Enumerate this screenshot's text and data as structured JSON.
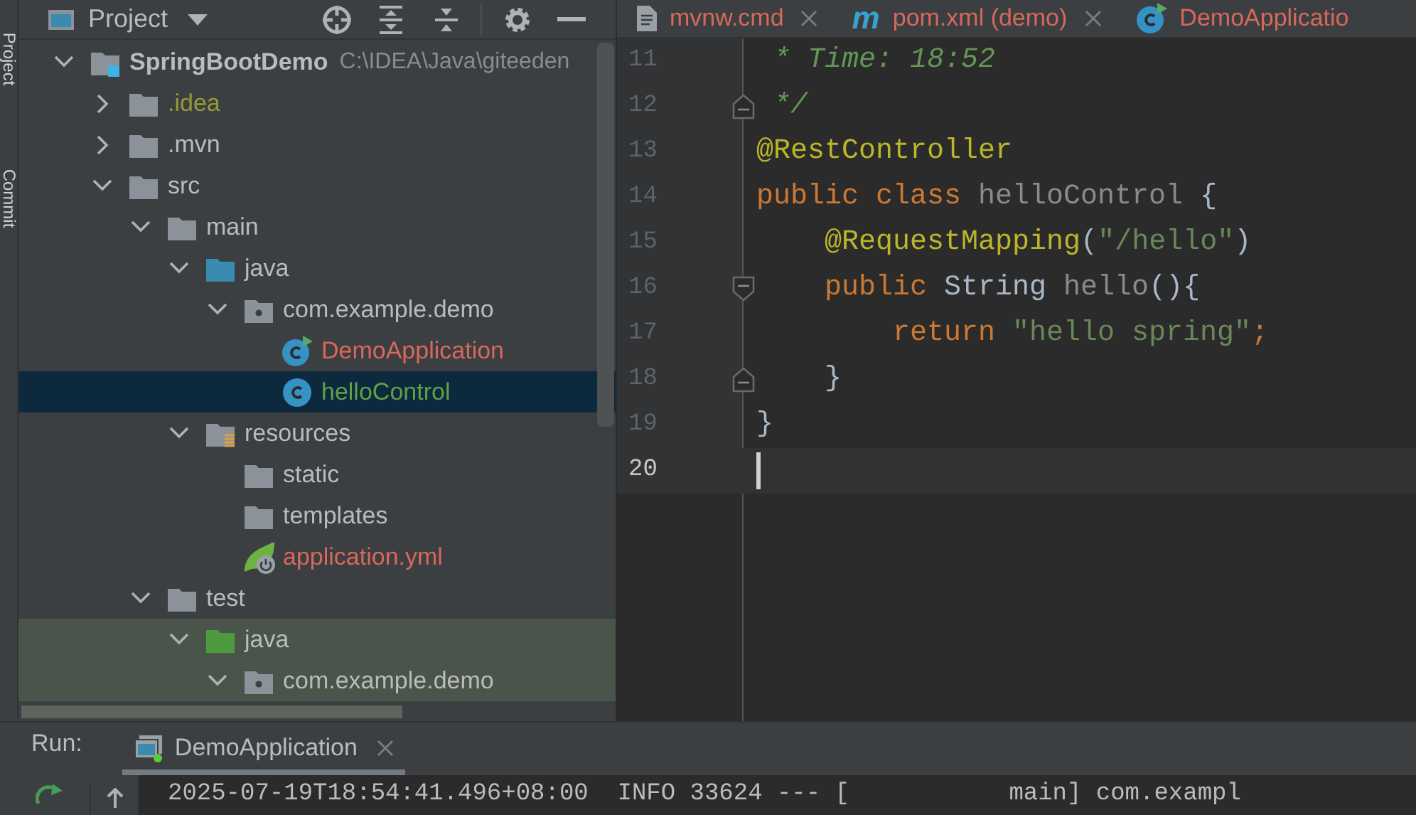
{
  "side_strip": {
    "labels": [
      "Project",
      "Commit"
    ]
  },
  "project_panel": {
    "title": "Project",
    "tree": [
      {
        "label": "SpringBootDemo",
        "path": "C:\\IDEA\\Java\\giteeden",
        "kind": "project",
        "color": "#bbbbbb",
        "expanded": true,
        "selected": false,
        "test_scope": false,
        "children": [
          {
            "label": ".idea",
            "kind": "folder",
            "color": "#999933",
            "expanded": false,
            "selected": false,
            "test_scope": false
          },
          {
            "label": ".mvn",
            "kind": "folder",
            "color": "#bbbbbb",
            "expanded": false,
            "selected": false,
            "test_scope": false
          },
          {
            "label": "src",
            "kind": "folder",
            "color": "#bbbbbb",
            "expanded": true,
            "selected": false,
            "test_scope": false,
            "children": [
              {
                "label": "main",
                "kind": "folder",
                "color": "#bbbbbb",
                "expanded": true,
                "selected": false,
                "test_scope": false,
                "children": [
                  {
                    "label": "java",
                    "kind": "source-folder",
                    "color": "#bbbbbb",
                    "expanded": true,
                    "selected": false,
                    "test_scope": false,
                    "children": [
                      {
                        "label": "com.example.demo",
                        "kind": "package",
                        "color": "#bbbbbb",
                        "expanded": true,
                        "selected": false,
                        "test_scope": false,
                        "children": [
                          {
                            "label": "DemoApplication",
                            "kind": "main-class",
                            "color": "#d7685b",
                            "selected": false,
                            "test_scope": false
                          },
                          {
                            "label": "helloControl",
                            "kind": "class",
                            "color": "#62a046",
                            "selected": true,
                            "test_scope": false
                          }
                        ]
                      }
                    ]
                  },
                  {
                    "label": "resources",
                    "kind": "resources-folder",
                    "color": "#bbbbbb",
                    "expanded": true,
                    "selected": false,
                    "test_scope": false,
                    "children": [
                      {
                        "label": "static",
                        "kind": "folder",
                        "color": "#bbbbbb",
                        "selected": false,
                        "test_scope": false
                      },
                      {
                        "label": "templates",
                        "kind": "folder",
                        "color": "#bbbbbb",
                        "selected": false,
                        "test_scope": false
                      },
                      {
                        "label": "application.yml",
                        "kind": "spring-config",
                        "color": "#d7685b",
                        "selected": false,
                        "test_scope": false
                      }
                    ]
                  }
                ]
              },
              {
                "label": "test",
                "kind": "folder",
                "color": "#bbbbbb",
                "expanded": true,
                "selected": false,
                "test_scope": false,
                "children": [
                  {
                    "label": "java",
                    "kind": "test-folder",
                    "color": "#bbbbbb",
                    "expanded": true,
                    "selected": false,
                    "test_scope": true,
                    "children": [
                      {
                        "label": "com.example.demo",
                        "kind": "package",
                        "color": "#bbbbbb",
                        "expanded": true,
                        "selected": false,
                        "test_scope": true
                      }
                    ]
                  }
                ]
              }
            ]
          }
        ]
      }
    ]
  },
  "editor": {
    "tabs": [
      {
        "label": "mvnw.cmd",
        "kind": "file",
        "selected": false
      },
      {
        "label": "pom.xml (demo)",
        "kind": "maven",
        "icon_text": "m",
        "selected": false
      },
      {
        "label": "DemoApplicatio",
        "kind": "main-class",
        "selected": false
      }
    ],
    "lines": [
      {
        "number": "11",
        "fold_open": false,
        "fold_close": false,
        "current": false,
        "tokens": [
          {
            "text": " * Time: 18:52",
            "kind": "comment"
          }
        ]
      },
      {
        "number": "12",
        "fold_open": false,
        "fold_close": true,
        "current": false,
        "tokens": [
          {
            "text": " */",
            "kind": "comment"
          }
        ]
      },
      {
        "number": "13",
        "fold_open": false,
        "fold_close": false,
        "current": false,
        "tokens": [
          {
            "text": "@RestController",
            "kind": "annotation"
          }
        ]
      },
      {
        "number": "14",
        "fold_open": false,
        "fold_close": false,
        "current": false,
        "tokens": [
          {
            "text": "public class ",
            "kind": "keyword"
          },
          {
            "text": "helloControl",
            "kind": "unused"
          },
          {
            "text": " {",
            "kind": "plain"
          }
        ]
      },
      {
        "number": "15",
        "fold_open": false,
        "fold_close": false,
        "current": false,
        "tokens": [
          {
            "text": "    @RequestMapping",
            "kind": "annotation"
          },
          {
            "text": "(",
            "kind": "plain"
          },
          {
            "text": "\"/hello\"",
            "kind": "string"
          },
          {
            "text": ")",
            "kind": "plain"
          }
        ]
      },
      {
        "number": "16",
        "fold_open": true,
        "fold_close": false,
        "current": false,
        "tokens": [
          {
            "text": "    public ",
            "kind": "keyword"
          },
          {
            "text": "String ",
            "kind": "plain"
          },
          {
            "text": "hello",
            "kind": "unused"
          },
          {
            "text": "(){",
            "kind": "plain"
          }
        ]
      },
      {
        "number": "17",
        "fold_open": false,
        "fold_close": false,
        "current": false,
        "tokens": [
          {
            "text": "        return ",
            "kind": "keyword"
          },
          {
            "text": "\"hello spring\"",
            "kind": "string"
          },
          {
            "text": ";",
            "kind": "keyword"
          }
        ]
      },
      {
        "number": "18",
        "fold_open": false,
        "fold_close": true,
        "current": false,
        "tokens": [
          {
            "text": "    }",
            "kind": "plain"
          }
        ]
      },
      {
        "number": "19",
        "fold_open": false,
        "fold_close": false,
        "current": false,
        "tokens": [
          {
            "text": "}",
            "kind": "plain"
          }
        ]
      },
      {
        "number": "20",
        "fold_open": false,
        "fold_close": false,
        "current": true
      }
    ]
  },
  "run_panel": {
    "label": "Run:",
    "tabs": [
      {
        "label": "DemoApplication",
        "selected": true
      }
    ],
    "console_lines": [
      "2025-07-19T18:54:41.496+08:00  INFO 33624 --- [           main] com.exampl"
    ]
  }
}
